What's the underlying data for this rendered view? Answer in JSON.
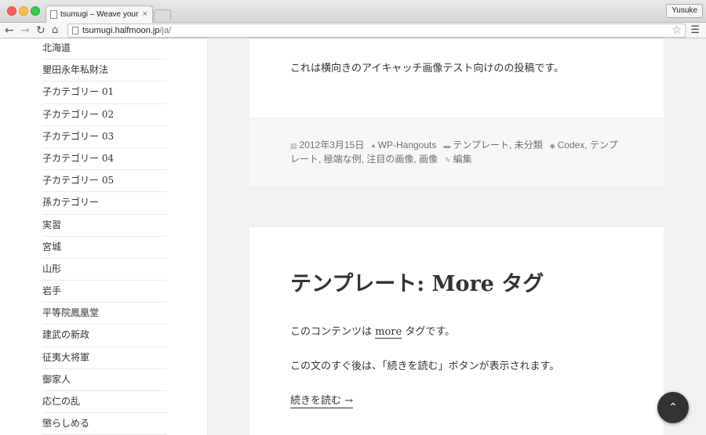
{
  "browser": {
    "tab_title": "tsumugi – Weave your wor",
    "tab_close": "×",
    "profile_name": "Yusuke",
    "url_host": "tsumugi.halfmoon.jp",
    "url_path": "/ja/",
    "icons": [
      "back-arrow-icon",
      "forward-arrow-icon",
      "reload-icon",
      "home-icon",
      "star-icon",
      "hamburger-menu-icon"
    ]
  },
  "sidebar": {
    "categories": [
      "北海道",
      "墾田永年私財法",
      "子カテゴリー 01",
      "子カテゴリー 02",
      "子カテゴリー 03",
      "子カテゴリー 04",
      "子カテゴリー 05",
      "孫カテゴリー",
      "実習",
      "宮城",
      "山形",
      "岩手",
      "平等院鳳凰堂",
      "建武の新政",
      "征夷大将軍",
      "御家人",
      "応仁の乱",
      "懲らしめる"
    ]
  },
  "post1": {
    "body": "これは横向きのアイキャッチ画像テスト向けのの投稿です。",
    "meta": {
      "date": "2012年3月15日",
      "author": "WP-Hangouts",
      "categories": "テンプレート, 未分類",
      "tags_line1": "Codex, テンプ",
      "tags_line2": "レート, 極端な例, 注目の画像, 画像",
      "edit": "編集"
    }
  },
  "post2": {
    "title": "テンプレート: More タグ",
    "p1_before": "このコンテンツは ",
    "p1_link": "more",
    "p1_after": " タグです。",
    "p2": "この文のすぐ後は、「続きを読む」ボタンが表示されます。",
    "read_more": "続きを読む →"
  },
  "scroll_top_label": "⌃",
  "colors": {
    "page_bg": "#f1f1f1",
    "card_bg": "#ffffff",
    "footer_bg": "#f7f7f7",
    "text": "#333333",
    "meta_text": "#707070"
  }
}
